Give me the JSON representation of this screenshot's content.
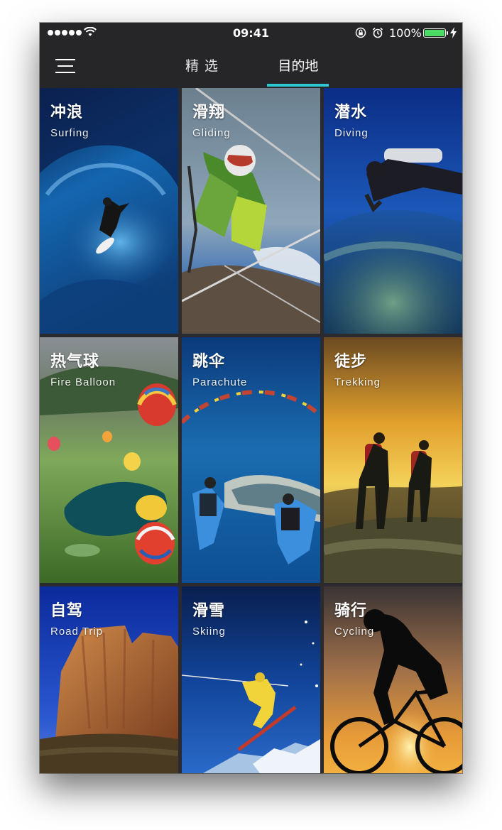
{
  "status_bar": {
    "time": "09:41",
    "battery": "100%",
    "colors": {
      "battery_fill": "#4cd964"
    }
  },
  "nav": {
    "tabs": [
      {
        "label": "精选",
        "active": false
      },
      {
        "label": "目的地",
        "active": true
      }
    ],
    "accent": "#2fc6d4"
  },
  "destinations": [
    {
      "cn": "冲浪",
      "en": "Surfing"
    },
    {
      "cn": "滑翔",
      "en": "Gliding"
    },
    {
      "cn": "潜水",
      "en": "Diving"
    },
    {
      "cn": "热气球",
      "en": "Fire Balloon"
    },
    {
      "cn": "跳伞",
      "en": "Parachute"
    },
    {
      "cn": "徒步",
      "en": "Trekking"
    },
    {
      "cn": "自驾",
      "en": "Road Trip"
    },
    {
      "cn": "滑雪",
      "en": "Skiing"
    },
    {
      "cn": "骑行",
      "en": "Cycling"
    }
  ]
}
